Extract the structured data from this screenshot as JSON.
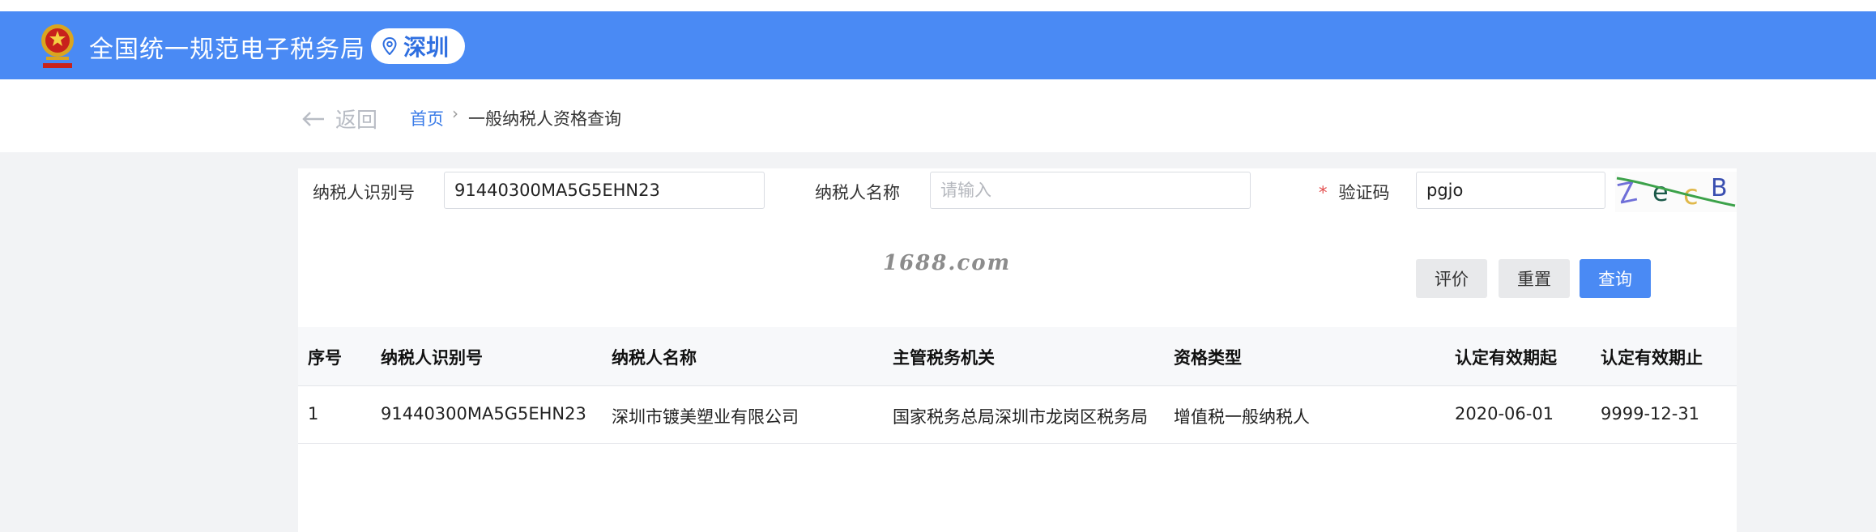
{
  "header": {
    "site_title": "全国统一规范电子税务局",
    "city": "深圳"
  },
  "breadcrumb": {
    "back_label": "返回",
    "home_label": "首页",
    "separator": "›",
    "current": "一般纳税人资格查询"
  },
  "form": {
    "taxpayer_id_label": "纳税人识别号",
    "taxpayer_id_value": "91440300MA5G5EHN23",
    "taxpayer_name_label": "纳税人名称",
    "taxpayer_name_placeholder": "请输入",
    "captcha_required_mark": "*",
    "captcha_label": "验证码",
    "captcha_value": "pgjo",
    "captcha_image_text": "ZecB"
  },
  "watermark": "1688.com",
  "buttons": {
    "rate": "评价",
    "reset": "重置",
    "query": "查询"
  },
  "table": {
    "columns": [
      "序号",
      "纳税人识别号",
      "纳税人名称",
      "主管税务机关",
      "资格类型",
      "认定有效期起",
      "认定有效期止"
    ],
    "rows": [
      [
        "1",
        "91440300MA5G5EHN23",
        "深圳市镀美塑业有限公司",
        "国家税务总局深圳市龙岗区税务局",
        "增值税一般纳税人",
        "2020-06-01",
        "9999-12-31"
      ]
    ]
  },
  "colors": {
    "header_blue": "#4a8af4",
    "link_blue": "#3b7ce8",
    "required_red": "#e34d4d"
  },
  "icons": {
    "emblem": "national-tax-emblem-icon",
    "location": "location-pin-icon",
    "back": "arrow-left-icon"
  }
}
